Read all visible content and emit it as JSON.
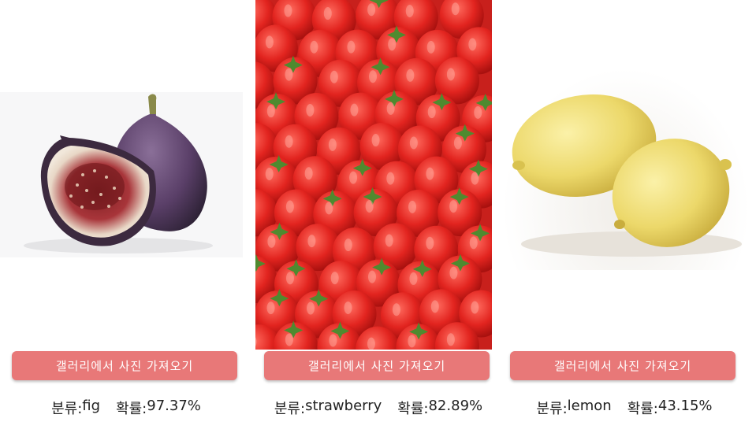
{
  "panels": [
    {
      "id": "fig",
      "image": "fig-photo",
      "button_label": "갤러리에서 사진 가져오기",
      "class_label": "분류:",
      "class_value": "fig",
      "prob_label": "확률:",
      "prob_value": "97.37%"
    },
    {
      "id": "strawberry",
      "image": "strawberry-photo",
      "button_label": "갤러리에서 사진 가져오기",
      "class_label": "분류:",
      "class_value": "strawberry",
      "prob_label": "확률:",
      "prob_value": "82.89%"
    },
    {
      "id": "lemon",
      "image": "lemon-photo",
      "button_label": "갤러리에서 사진 가져오기",
      "class_label": "분류:",
      "class_value": "lemon",
      "prob_label": "확률:",
      "prob_value": "43.15%"
    }
  ],
  "colors": {
    "button_bg": "#e87878",
    "button_text": "#ffffff",
    "result_text": "#222222"
  }
}
